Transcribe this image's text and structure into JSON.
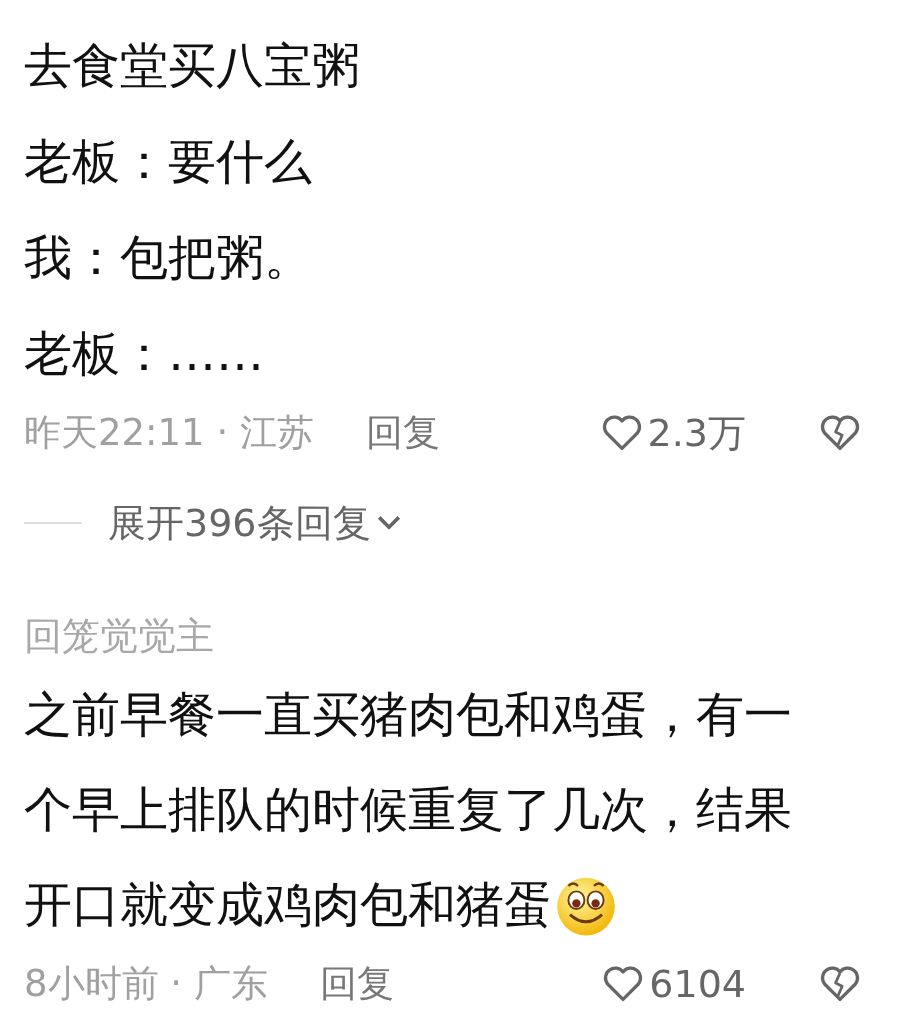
{
  "comments": [
    {
      "lines": [
        "去食堂买八宝粥",
        "老板：要什么",
        "我：包把粥。",
        "老板：……"
      ],
      "trailing_emoji": false,
      "meta": "昨天22:11 · 江苏",
      "reply": "回复",
      "likes": "2.3万",
      "expand": "展开396条回复"
    },
    {
      "author": "回笼觉觉主",
      "lines": [
        "之前早餐一直买猪肉包和鸡蛋，有一",
        "个早上排队的时候重复了几次，结果",
        "开口就变成鸡肉包和猪蛋"
      ],
      "trailing_emoji": true,
      "meta": "8小时前 · 广东",
      "reply": "回复",
      "likes": "6104"
    }
  ]
}
